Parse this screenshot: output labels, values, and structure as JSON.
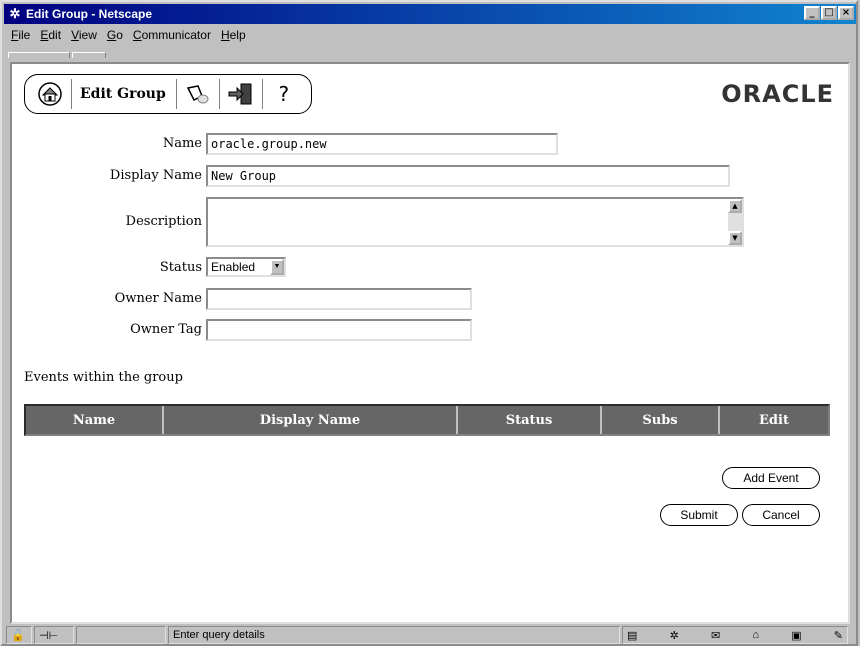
{
  "window": {
    "title": "Edit Group - Netscape",
    "controls": [
      "_",
      "□",
      "×"
    ]
  },
  "menu": [
    "File",
    "Edit",
    "View",
    "Go",
    "Communicator",
    "Help"
  ],
  "toolbar": {
    "title": "Edit Group",
    "icons": [
      "home-icon",
      "flashlight-icon",
      "exit-door-icon",
      "help-icon"
    ],
    "help_glyph": "?"
  },
  "brand": {
    "logo": "ORACLE"
  },
  "form": {
    "name_label": "Name",
    "name_value": "oracle.group.new",
    "display_name_label": "Display Name",
    "display_name_value": "New Group",
    "description_label": "Description",
    "description_value": "",
    "status_label": "Status",
    "status_value": "Enabled",
    "owner_name_label": "Owner Name",
    "owner_name_value": "",
    "owner_tag_label": "Owner Tag",
    "owner_tag_value": ""
  },
  "events": {
    "section_label": "Events within the group",
    "columns": [
      "Name",
      "Display Name",
      "Status",
      "Subs",
      "Edit"
    ]
  },
  "buttons": {
    "add_event": "Add Event",
    "submit": "Submit",
    "cancel": "Cancel"
  },
  "statusbar": {
    "message": "Enter query details"
  }
}
